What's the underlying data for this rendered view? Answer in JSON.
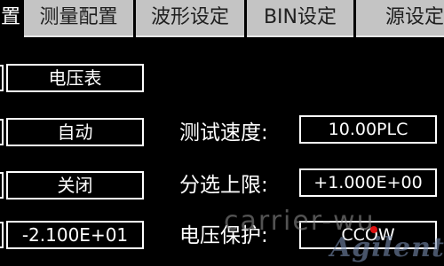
{
  "tabs": [
    {
      "label": "置",
      "active": true
    },
    {
      "label": "测量配置",
      "active": false
    },
    {
      "label": "波形设定",
      "active": false
    },
    {
      "label": "BIN设定",
      "active": false
    },
    {
      "label": "源设定",
      "active": false
    }
  ],
  "left_fields": [
    {
      "value": "电压表"
    },
    {
      "value": "自动"
    },
    {
      "value": "关闭"
    },
    {
      "value": "-2.100E+01"
    }
  ],
  "right_fields": [
    {
      "label": "测试速度:",
      "value": "10.00PLC"
    },
    {
      "label": "分选上限:",
      "value": "+1.000E+00"
    },
    {
      "label": "电压保护:",
      "value": "CCOW"
    }
  ],
  "watermark": {
    "text": "carrier-wu",
    "logo": "Agilent"
  },
  "colors": {
    "tab_inactive_bg": "#c4c4c4",
    "tab_active_bg": "#000000",
    "screen_bg": "#000000",
    "box_border": "#ffffff"
  }
}
